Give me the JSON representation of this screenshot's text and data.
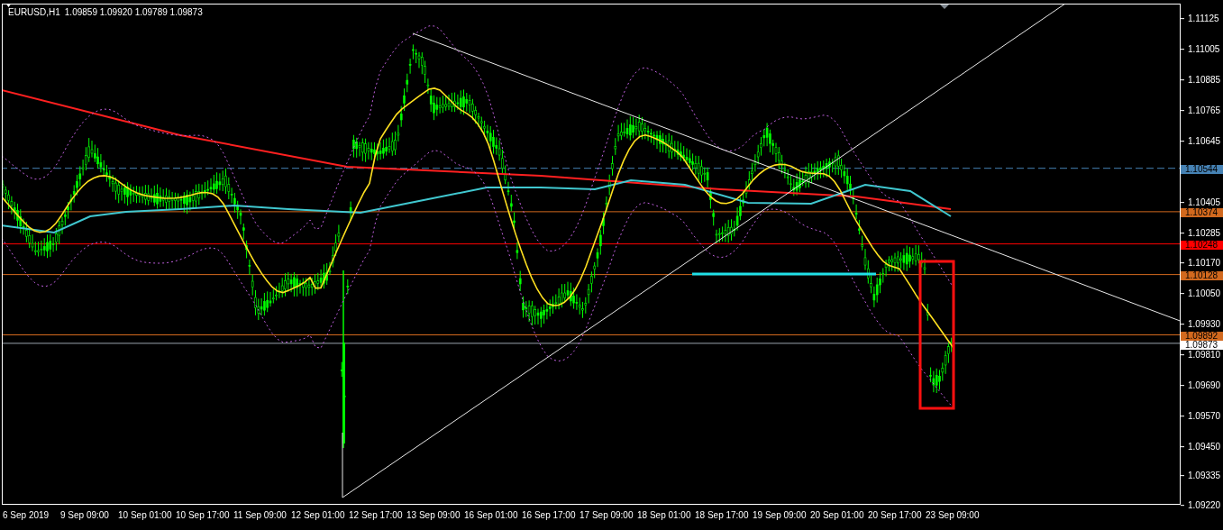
{
  "header": {
    "symbol": "EURUSD,H1",
    "ohlc": "1.09859 1.09920 1.09789 1.09873"
  },
  "price_axis": {
    "ticks": [
      "1.11125",
      "1.11005",
      "1.10885",
      "1.10765",
      "1.10645",
      "1.10405",
      "1.10285",
      "1.10170",
      "1.10050",
      "1.09930",
      "1.09810",
      "1.09690",
      "1.09570",
      "1.09450",
      "1.09335",
      "1.09220"
    ]
  },
  "price_levels": [
    {
      "label": "1.10544",
      "color": "#4682b4",
      "kind": "dashed"
    },
    {
      "label": "1.10374",
      "color": "#d2691e",
      "kind": "solid"
    },
    {
      "label": "1.10248",
      "color": "#ff0000",
      "kind": "solid"
    },
    {
      "label": "1.10128",
      "color": "#d2691e",
      "kind": "solid"
    },
    {
      "label": "1.09892",
      "color": "#d2691e",
      "kind": "solid"
    },
    {
      "label": "1.09873",
      "color": "#ffffff",
      "kind": "solid"
    }
  ],
  "time_axis": {
    "labels": [
      "6 Sep 2019",
      "9 Sep 09:00",
      "10 Sep 01:00",
      "10 Sep 17:00",
      "11 Sep 09:00",
      "12 Sep 01:00",
      "12 Sep 17:00",
      "13 Sep 09:00",
      "16 Sep 01:00",
      "16 Sep 17:00",
      "17 Sep 09:00",
      "18 Sep 01:00",
      "18 Sep 17:00",
      "19 Sep 09:00",
      "20 Sep 01:00",
      "20 Sep 17:00",
      "23 Sep 09:00"
    ]
  }
}
